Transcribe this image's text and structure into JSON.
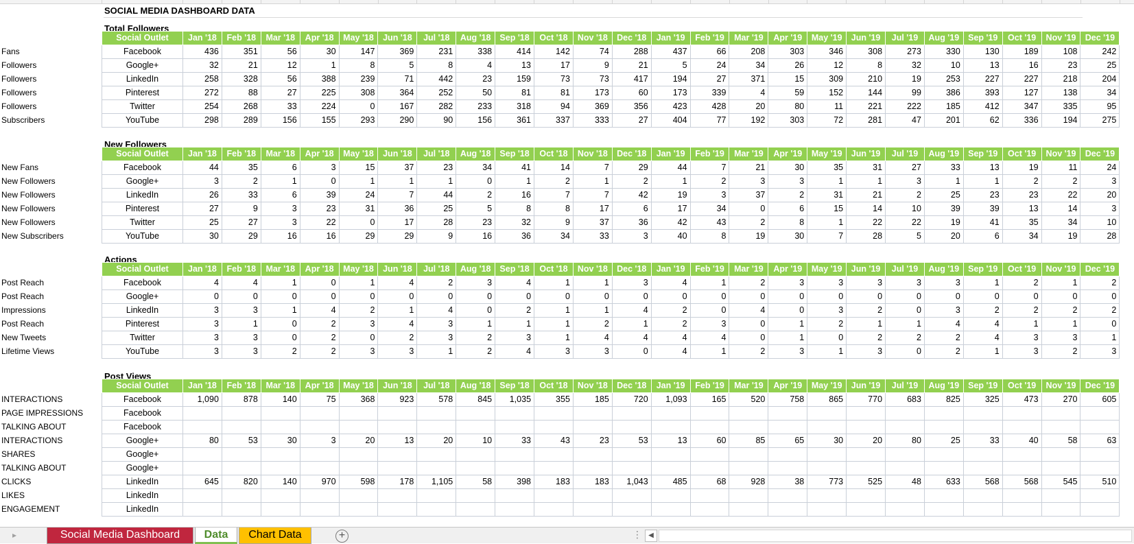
{
  "title": "SOCIAL MEDIA DASHBOARD DATA",
  "months": [
    "Jan '18",
    "Feb '18",
    "Mar '18",
    "Apr '18",
    "May '18",
    "Jun '18",
    "Jul '18",
    "Aug '18",
    "Sep '18",
    "Oct '18",
    "Nov '18",
    "Dec '18",
    "Jan '19",
    "Feb '19",
    "Mar '19",
    "Apr '19",
    "May '19",
    "Jun '19",
    "Jul '19",
    "Aug '19",
    "Sep '19",
    "Oct '19",
    "Nov '19",
    "Dec '19"
  ],
  "header_label": "Social Outlet",
  "sections": [
    {
      "title": "Total Followers",
      "rows": [
        {
          "label": "Fans",
          "outlet": "Facebook",
          "values": [
            "436",
            "351",
            "56",
            "30",
            "147",
            "369",
            "231",
            "338",
            "414",
            "142",
            "74",
            "288",
            "437",
            "66",
            "208",
            "303",
            "346",
            "308",
            "273",
            "330",
            "130",
            "189",
            "108",
            "242"
          ]
        },
        {
          "label": "Followers",
          "outlet": "Google+",
          "values": [
            "32",
            "21",
            "12",
            "1",
            "8",
            "5",
            "8",
            "4",
            "13",
            "17",
            "9",
            "21",
            "5",
            "24",
            "34",
            "26",
            "12",
            "8",
            "32",
            "10",
            "13",
            "16",
            "23",
            "25"
          ]
        },
        {
          "label": "Followers",
          "outlet": "LinkedIn",
          "values": [
            "258",
            "328",
            "56",
            "388",
            "239",
            "71",
            "442",
            "23",
            "159",
            "73",
            "73",
            "417",
            "194",
            "27",
            "371",
            "15",
            "309",
            "210",
            "19",
            "253",
            "227",
            "227",
            "218",
            "204"
          ]
        },
        {
          "label": "Followers",
          "outlet": "Pinterest",
          "values": [
            "272",
            "88",
            "27",
            "225",
            "308",
            "364",
            "252",
            "50",
            "81",
            "81",
            "173",
            "60",
            "173",
            "339",
            "4",
            "59",
            "152",
            "144",
            "99",
            "386",
            "393",
            "127",
            "138",
            "34"
          ]
        },
        {
          "label": "Followers",
          "outlet": "Twitter",
          "values": [
            "254",
            "268",
            "33",
            "224",
            "0",
            "167",
            "282",
            "233",
            "318",
            "94",
            "369",
            "356",
            "423",
            "428",
            "20",
            "80",
            "11",
            "221",
            "222",
            "185",
            "412",
            "347",
            "335",
            "95"
          ]
        },
        {
          "label": "Subscribers",
          "outlet": "YouTube",
          "values": [
            "298",
            "289",
            "156",
            "155",
            "293",
            "290",
            "90",
            "156",
            "361",
            "337",
            "333",
            "27",
            "404",
            "77",
            "192",
            "303",
            "72",
            "281",
            "47",
            "201",
            "62",
            "336",
            "194",
            "275"
          ]
        }
      ]
    },
    {
      "title": "New Followers",
      "rows": [
        {
          "label": "New Fans",
          "outlet": "Facebook",
          "values": [
            "44",
            "35",
            "6",
            "3",
            "15",
            "37",
            "23",
            "34",
            "41",
            "14",
            "7",
            "29",
            "44",
            "7",
            "21",
            "30",
            "35",
            "31",
            "27",
            "33",
            "13",
            "19",
            "11",
            "24"
          ]
        },
        {
          "label": "New Followers",
          "outlet": "Google+",
          "values": [
            "3",
            "2",
            "1",
            "0",
            "1",
            "1",
            "1",
            "0",
            "1",
            "2",
            "1",
            "2",
            "1",
            "2",
            "3",
            "3",
            "1",
            "1",
            "3",
            "1",
            "1",
            "2",
            "2",
            "3"
          ]
        },
        {
          "label": "New Followers",
          "outlet": "LinkedIn",
          "values": [
            "26",
            "33",
            "6",
            "39",
            "24",
            "7",
            "44",
            "2",
            "16",
            "7",
            "7",
            "42",
            "19",
            "3",
            "37",
            "2",
            "31",
            "21",
            "2",
            "25",
            "23",
            "23",
            "22",
            "20"
          ]
        },
        {
          "label": "New Followers",
          "outlet": "Pinterest",
          "values": [
            "27",
            "9",
            "3",
            "23",
            "31",
            "36",
            "25",
            "5",
            "8",
            "8",
            "17",
            "6",
            "17",
            "34",
            "0",
            "6",
            "15",
            "14",
            "10",
            "39",
            "39",
            "13",
            "14",
            "3"
          ]
        },
        {
          "label": "New Followers",
          "outlet": "Twitter",
          "values": [
            "25",
            "27",
            "3",
            "22",
            "0",
            "17",
            "28",
            "23",
            "32",
            "9",
            "37",
            "36",
            "42",
            "43",
            "2",
            "8",
            "1",
            "22",
            "22",
            "19",
            "41",
            "35",
            "34",
            "10"
          ]
        },
        {
          "label": "New Subscribers",
          "outlet": "YouTube",
          "values": [
            "30",
            "29",
            "16",
            "16",
            "29",
            "29",
            "9",
            "16",
            "36",
            "34",
            "33",
            "3",
            "40",
            "8",
            "19",
            "30",
            "7",
            "28",
            "5",
            "20",
            "6",
            "34",
            "19",
            "28"
          ]
        }
      ]
    },
    {
      "title": "Actions",
      "rows": [
        {
          "label": "Post Reach",
          "outlet": "Facebook",
          "values": [
            "4",
            "4",
            "1",
            "0",
            "1",
            "4",
            "2",
            "3",
            "4",
            "1",
            "1",
            "3",
            "4",
            "1",
            "2",
            "3",
            "3",
            "3",
            "3",
            "3",
            "1",
            "2",
            "1",
            "2"
          ]
        },
        {
          "label": "Post Reach",
          "outlet": "Google+",
          "values": [
            "0",
            "0",
            "0",
            "0",
            "0",
            "0",
            "0",
            "0",
            "0",
            "0",
            "0",
            "0",
            "0",
            "0",
            "0",
            "0",
            "0",
            "0",
            "0",
            "0",
            "0",
            "0",
            "0",
            "0"
          ]
        },
        {
          "label": "Impressions",
          "outlet": "LinkedIn",
          "values": [
            "3",
            "3",
            "1",
            "4",
            "2",
            "1",
            "4",
            "0",
            "2",
            "1",
            "1",
            "4",
            "2",
            "0",
            "4",
            "0",
            "3",
            "2",
            "0",
            "3",
            "2",
            "2",
            "2",
            "2"
          ]
        },
        {
          "label": "Post Reach",
          "outlet": "Pinterest",
          "values": [
            "3",
            "1",
            "0",
            "2",
            "3",
            "4",
            "3",
            "1",
            "1",
            "1",
            "2",
            "1",
            "2",
            "3",
            "0",
            "1",
            "2",
            "1",
            "1",
            "4",
            "4",
            "1",
            "1",
            "0"
          ]
        },
        {
          "label": "New Tweets",
          "outlet": "Twitter",
          "values": [
            "3",
            "3",
            "0",
            "2",
            "0",
            "2",
            "3",
            "2",
            "3",
            "1",
            "4",
            "4",
            "4",
            "4",
            "0",
            "1",
            "0",
            "2",
            "2",
            "2",
            "4",
            "3",
            "3",
            "1"
          ]
        },
        {
          "label": "Lifetime Views",
          "outlet": "YouTube",
          "values": [
            "3",
            "3",
            "2",
            "2",
            "3",
            "3",
            "1",
            "2",
            "4",
            "3",
            "3",
            "0",
            "4",
            "1",
            "2",
            "3",
            "1",
            "3",
            "0",
            "2",
            "1",
            "3",
            "2",
            "3"
          ]
        }
      ]
    },
    {
      "title": "Post Views",
      "rows": [
        {
          "label": "INTERACTIONS",
          "outlet": "Facebook",
          "values": [
            "1,090",
            "878",
            "140",
            "75",
            "368",
            "923",
            "578",
            "845",
            "1,035",
            "355",
            "185",
            "720",
            "1,093",
            "165",
            "520",
            "758",
            "865",
            "770",
            "683",
            "825",
            "325",
            "473",
            "270",
            "605"
          ]
        },
        {
          "label": "PAGE IMPRESSIONS",
          "outlet": "Facebook",
          "values": [
            "",
            "",
            "",
            "",
            "",
            "",
            "",
            "",
            "",
            "",
            "",
            "",
            "",
            "",
            "",
            "",
            "",
            "",
            "",
            "",
            "",
            "",
            "",
            ""
          ]
        },
        {
          "label": "TALKING ABOUT",
          "outlet": "Facebook",
          "values": [
            "",
            "",
            "",
            "",
            "",
            "",
            "",
            "",
            "",
            "",
            "",
            "",
            "",
            "",
            "",
            "",
            "",
            "",
            "",
            "",
            "",
            "",
            "",
            ""
          ]
        },
        {
          "label": "INTERACTIONS",
          "outlet": "Google+",
          "values": [
            "80",
            "53",
            "30",
            "3",
            "20",
            "13",
            "20",
            "10",
            "33",
            "43",
            "23",
            "53",
            "13",
            "60",
            "85",
            "65",
            "30",
            "20",
            "80",
            "25",
            "33",
            "40",
            "58",
            "63"
          ]
        },
        {
          "label": "SHARES",
          "outlet": "Google+",
          "values": [
            "",
            "",
            "",
            "",
            "",
            "",
            "",
            "",
            "",
            "",
            "",
            "",
            "",
            "",
            "",
            "",
            "",
            "",
            "",
            "",
            "",
            "",
            "",
            ""
          ]
        },
        {
          "label": "TALKING ABOUT",
          "outlet": "Google+",
          "values": [
            "",
            "",
            "",
            "",
            "",
            "",
            "",
            "",
            "",
            "",
            "",
            "",
            "",
            "",
            "",
            "",
            "",
            "",
            "",
            "",
            "",
            "",
            "",
            ""
          ]
        },
        {
          "label": "CLICKS",
          "outlet": "LinkedIn",
          "values": [
            "645",
            "820",
            "140",
            "970",
            "598",
            "178",
            "1,105",
            "58",
            "398",
            "183",
            "183",
            "1,043",
            "485",
            "68",
            "928",
            "38",
            "773",
            "525",
            "48",
            "633",
            "568",
            "568",
            "545",
            "510"
          ]
        },
        {
          "label": "LIKES",
          "outlet": "LinkedIn",
          "values": [
            "",
            "",
            "",
            "",
            "",
            "",
            "",
            "",
            "",
            "",
            "",
            "",
            "",
            "",
            "",
            "",
            "",
            "",
            "",
            "",
            "",
            "",
            "",
            ""
          ]
        },
        {
          "label": "ENGAGEMENT",
          "outlet": "LinkedIn",
          "values": [
            "",
            "",
            "",
            "",
            "",
            "",
            "",
            "",
            "",
            "",
            "",
            "",
            "",
            "",
            "",
            "",
            "",
            "",
            "",
            "",
            "",
            "",
            "",
            ""
          ]
        }
      ]
    }
  ],
  "tabs": [
    {
      "label": "Social Media Dashboard",
      "color": "#c0263e"
    },
    {
      "label": "Data",
      "color": "#4f8c2b",
      "active": true
    },
    {
      "label": "Chart Data",
      "color": "#ffc000"
    }
  ],
  "colors": {
    "header_fill": "#92d050",
    "header_text": "#ffffff",
    "grid": "#c9cfd8"
  }
}
